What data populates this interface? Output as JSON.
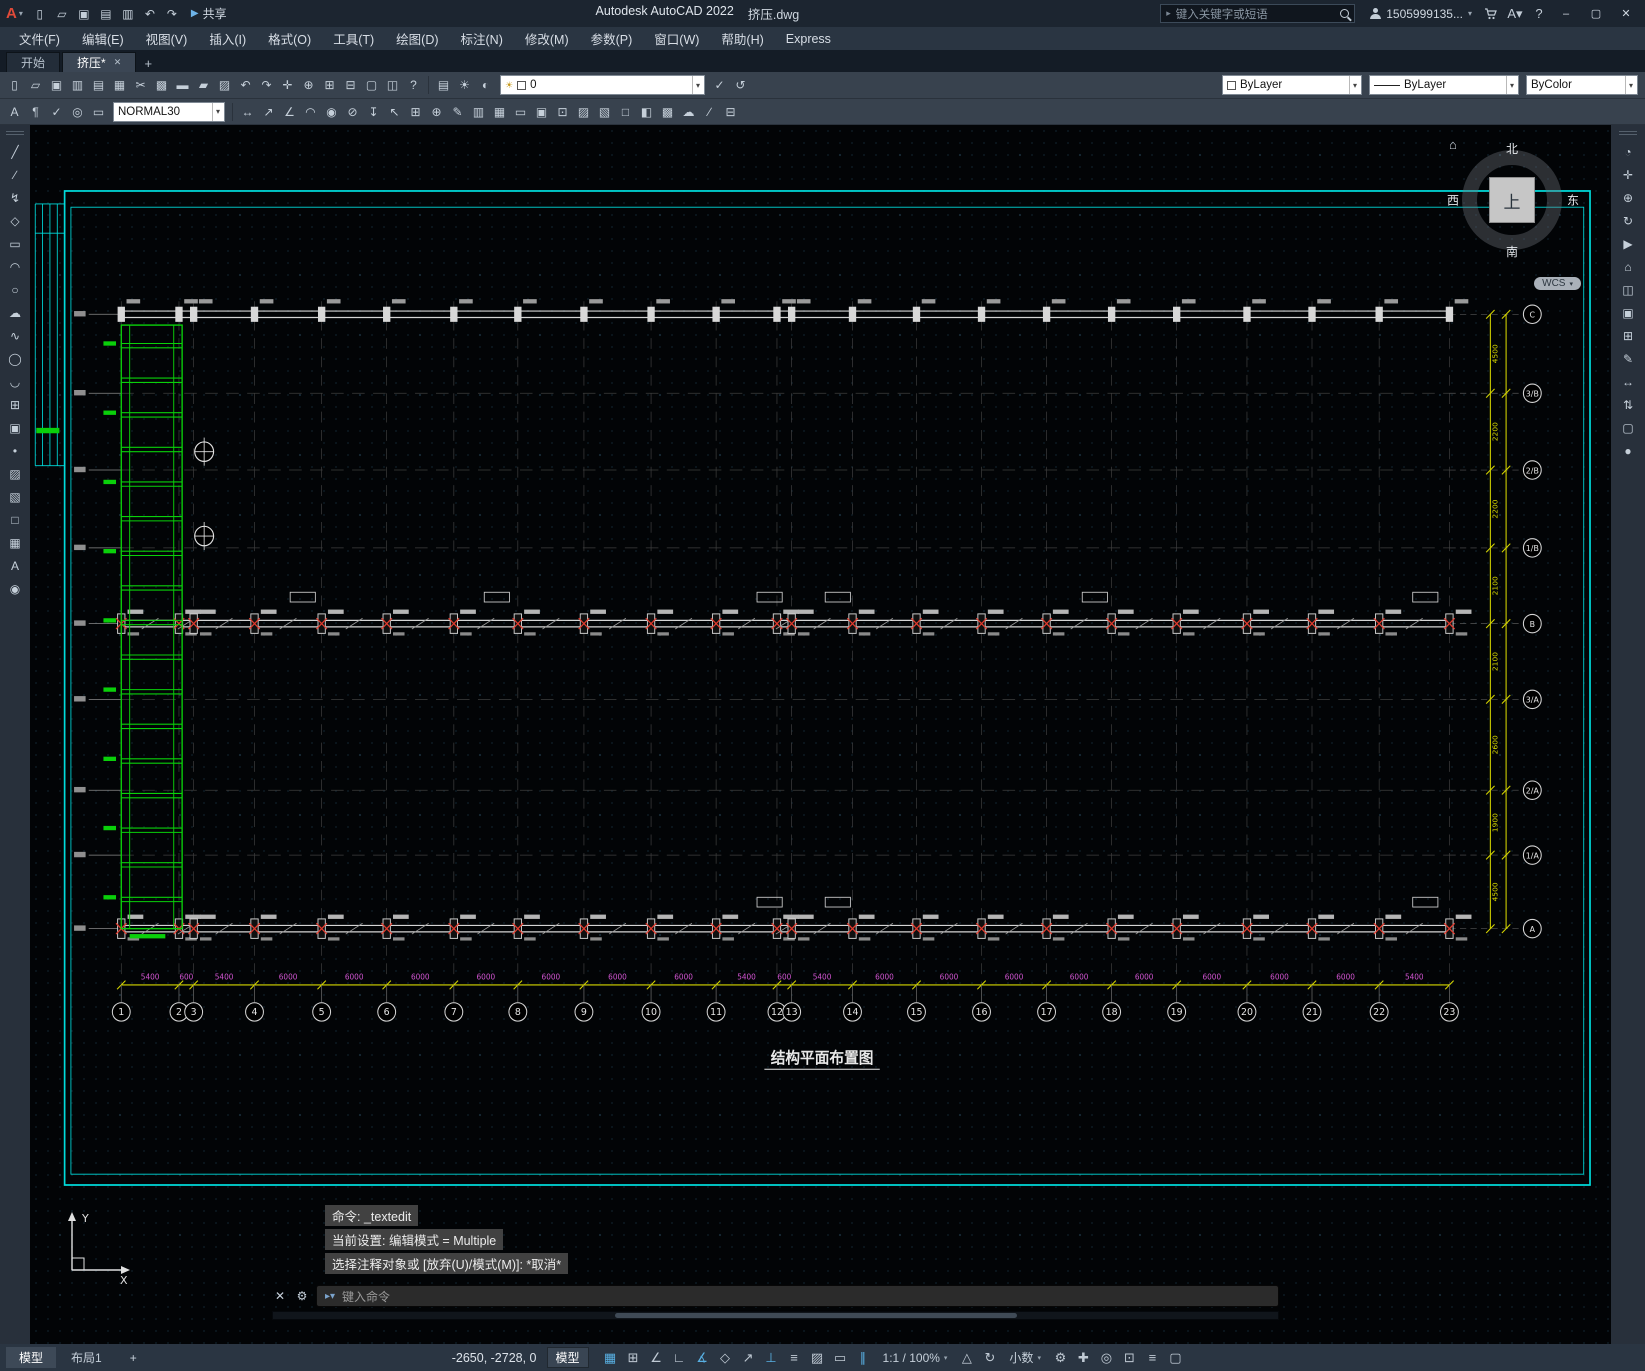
{
  "titlebar": {
    "app_title": "Autodesk AutoCAD 2022",
    "doc_title": "挤压.dwg",
    "share_label": "共享",
    "search_placeholder": "键入关键字或短语",
    "account": "1505999135...",
    "window_buttons": {
      "minimize": "–",
      "maximize": "▢",
      "close": "✕"
    },
    "quick_access": [
      {
        "name": "qnew",
        "glyph": "▯"
      },
      {
        "name": "open",
        "glyph": "▱"
      },
      {
        "name": "qsave",
        "glyph": "▣"
      },
      {
        "name": "save-as",
        "glyph": "▤"
      },
      {
        "name": "plot",
        "glyph": "▥"
      },
      {
        "name": "undo",
        "glyph": "↶"
      },
      {
        "name": "redo",
        "glyph": "↷"
      }
    ]
  },
  "menubar": {
    "items": [
      "文件(F)",
      "编辑(E)",
      "视图(V)",
      "插入(I)",
      "格式(O)",
      "工具(T)",
      "绘图(D)",
      "标注(N)",
      "修改(M)",
      "参数(P)",
      "窗口(W)",
      "帮助(H)",
      "Express"
    ]
  },
  "tabs": {
    "items": [
      {
        "label": "开始",
        "active": false
      },
      {
        "label": "挤压*",
        "active": true
      }
    ],
    "close_glyph": "✕",
    "new_tab": "+"
  },
  "toolbar1": {
    "icons_left": [
      {
        "name": "qnew",
        "glyph": "▯"
      },
      {
        "name": "open",
        "glyph": "▱"
      },
      {
        "name": "qsave",
        "glyph": "▣"
      },
      {
        "name": "plot",
        "glyph": "▥"
      },
      {
        "name": "plot-preview",
        "glyph": "▤"
      },
      {
        "name": "publish",
        "glyph": "▦"
      },
      {
        "name": "cut",
        "glyph": "✂"
      },
      {
        "name": "copy",
        "glyph": "▩"
      },
      {
        "name": "paste",
        "glyph": "▬"
      },
      {
        "name": "match-properties",
        "glyph": "▰"
      },
      {
        "name": "block-editor",
        "glyph": "▨"
      },
      {
        "name": "undo",
        "glyph": "↶"
      },
      {
        "name": "redo",
        "glyph": "↷"
      },
      {
        "name": "pan",
        "glyph": "✛"
      },
      {
        "name": "zoom-realtime",
        "glyph": "⊕"
      },
      {
        "name": "zoom-window",
        "glyph": "⊞"
      },
      {
        "name": "zoom-previous",
        "glyph": "⊟"
      },
      {
        "name": "properties",
        "glyph": "▢"
      },
      {
        "name": "design-center",
        "glyph": "◫"
      },
      {
        "name": "help",
        "glyph": "?"
      }
    ],
    "layer_icons": [
      {
        "name": "layer-properties",
        "glyph": "▤"
      },
      {
        "name": "layer-states",
        "glyph": "☀"
      },
      {
        "name": "layer-isolate",
        "glyph": "◐"
      }
    ],
    "layer_value": "0",
    "icons_mid": [
      {
        "name": "make-object-layer-current",
        "glyph": "✓"
      },
      {
        "name": "layer-previous",
        "glyph": "↺"
      }
    ],
    "color_value": "ByLayer",
    "linetype_value": "ByLayer",
    "plotstyle_value": "ByColor"
  },
  "toolbar2": {
    "icons_left": [
      {
        "name": "text",
        "glyph": "A"
      },
      {
        "name": "mtext",
        "glyph": "¶"
      },
      {
        "name": "spell-check",
        "glyph": "✓"
      },
      {
        "name": "find",
        "glyph": "◎"
      },
      {
        "name": "text-style",
        "glyph": "▭"
      }
    ],
    "style_value": "NORMAL30",
    "icons_right": [
      {
        "name": "dim-linear",
        "glyph": "↔"
      },
      {
        "name": "dim-aligned",
        "glyph": "↗"
      },
      {
        "name": "dim-angular",
        "glyph": "∠"
      },
      {
        "name": "dim-arc",
        "glyph": "◠"
      },
      {
        "name": "dim-radius",
        "glyph": "◉"
      },
      {
        "name": "dim-diameter",
        "glyph": "⊘"
      },
      {
        "name": "dim-ordinate",
        "glyph": "↧"
      },
      {
        "name": "multileader",
        "glyph": "↖"
      },
      {
        "name": "tolerance",
        "glyph": "⊞"
      },
      {
        "name": "center-mark",
        "glyph": "⊕"
      },
      {
        "name": "dim-edit",
        "glyph": "✎"
      },
      {
        "name": "dim-style",
        "glyph": "▥"
      },
      {
        "name": "table",
        "glyph": "▦"
      },
      {
        "name": "field",
        "glyph": "▭"
      },
      {
        "name": "make-block",
        "glyph": "▣"
      },
      {
        "name": "insert-block",
        "glyph": "⊡"
      },
      {
        "name": "hatch",
        "glyph": "▨"
      },
      {
        "name": "gradient",
        "glyph": "▧"
      },
      {
        "name": "boundary",
        "glyph": "□"
      },
      {
        "name": "region",
        "glyph": "◧"
      },
      {
        "name": "wipeout",
        "glyph": "▩"
      },
      {
        "name": "revision-cloud",
        "glyph": "☁"
      },
      {
        "name": "measure",
        "glyph": "∕"
      },
      {
        "name": "quick-calc",
        "glyph": "⊟"
      }
    ]
  },
  "left_palette": {
    "icons": [
      {
        "name": "line",
        "glyph": "╱"
      },
      {
        "name": "construction-line",
        "glyph": "∕"
      },
      {
        "name": "polyline",
        "glyph": "↯"
      },
      {
        "name": "polygon",
        "glyph": "◇"
      },
      {
        "name": "rectangle",
        "glyph": "▭"
      },
      {
        "name": "arc",
        "glyph": "◠"
      },
      {
        "name": "circle",
        "glyph": "○"
      },
      {
        "name": "revision-cloud",
        "glyph": "☁"
      },
      {
        "name": "spline",
        "glyph": "∿"
      },
      {
        "name": "ellipse",
        "glyph": "◯"
      },
      {
        "name": "ellipse-arc",
        "glyph": "◡"
      },
      {
        "name": "insert-block",
        "glyph": "⊞"
      },
      {
        "name": "create-block",
        "glyph": "▣"
      },
      {
        "name": "point",
        "glyph": "•"
      },
      {
        "name": "hatch",
        "glyph": "▨"
      },
      {
        "name": "gradient",
        "glyph": "▧"
      },
      {
        "name": "region",
        "glyph": "□"
      },
      {
        "name": "table",
        "glyph": "▦"
      },
      {
        "name": "multiline-text",
        "glyph": "A"
      },
      {
        "name": "color-tool",
        "glyph": "◉"
      }
    ]
  },
  "right_palette": {
    "icons": [
      {
        "name": "navigation-wheel",
        "glyph": "◔"
      },
      {
        "name": "pan",
        "glyph": "✛"
      },
      {
        "name": "zoom-extents",
        "glyph": "⊕"
      },
      {
        "name": "orbit",
        "glyph": "↻"
      },
      {
        "name": "show-motion",
        "glyph": "▶"
      },
      {
        "name": "home-view",
        "glyph": "⌂"
      },
      {
        "name": "view-manager",
        "glyph": "◫"
      },
      {
        "name": "named-views",
        "glyph": "▣"
      },
      {
        "name": "viewport-config",
        "glyph": "⊞"
      },
      {
        "name": "annotate",
        "glyph": "✎"
      },
      {
        "name": "move-view",
        "glyph": "↔"
      },
      {
        "name": "tilt-view",
        "glyph": "⇅"
      },
      {
        "name": "display-box",
        "glyph": "▢"
      },
      {
        "name": "render-dot",
        "glyph": "●"
      }
    ]
  },
  "canvas": {
    "compass": {
      "north": "北",
      "south": "南",
      "west": "西",
      "east": "东",
      "cube_top": "上"
    },
    "wcs_label": "WCS",
    "ucs": {
      "x_label": "X",
      "y_label": "Y"
    },
    "drawing": {
      "title": "结构平面布置图",
      "colors": {
        "outline": "#00dcdc",
        "beam": "#d4d4d4",
        "green": "#0ad00a",
        "yellow": "#d6d600",
        "red": "#e23b2e",
        "magenta": "#d255d2",
        "grid": "#454545"
      },
      "grid_labels": [
        "1",
        "2",
        "3",
        "4",
        "5",
        "6",
        "7",
        "8",
        "9",
        "10",
        "11",
        "12",
        "13",
        "14",
        "15",
        "16",
        "17",
        "18",
        "19",
        "20",
        "21",
        "22",
        "23"
      ],
      "grid_xs": [
        87,
        142,
        156,
        214,
        278,
        340,
        404,
        465,
        528,
        592,
        654,
        712,
        726,
        784,
        845,
        907,
        969,
        1031,
        1093,
        1160,
        1222,
        1286,
        1353
      ],
      "axis_labels": [
        "C",
        "3/B",
        "2/B",
        "1/B",
        "B",
        "3/A",
        "2/A",
        "1/A",
        "A"
      ],
      "axis_ys": [
        175,
        248,
        319,
        391,
        461,
        531,
        615,
        675,
        743
      ],
      "dims_bottom": [
        "5400",
        "600",
        "5400",
        "6000",
        "6000",
        "6000",
        "6000",
        "6000",
        "6000",
        "6000",
        "5400",
        "600",
        "5400",
        "6000",
        "6000",
        "6000",
        "6000",
        "6000",
        "6000",
        "6000",
        "6000",
        "5400"
      ],
      "dims_right": [
        "4500",
        "2200",
        "2200",
        "2100",
        "2100",
        "2600",
        "1900",
        "4500"
      ]
    }
  },
  "command": {
    "history": [
      "命令: _textedit",
      "当前设置: 编辑模式 = Multiple",
      "选择注释对象或 [放弃(U)/模式(M)]: *取消*"
    ],
    "prompt_placeholder": "键入命令"
  },
  "statusbar": {
    "layout_tabs": [
      "模型",
      "布局1"
    ],
    "new_layout": "+",
    "coords": "-2650, -2728, 0",
    "model_label": "模型",
    "icons_a": [
      {
        "name": "grid-display",
        "glyph": "▦",
        "active": true
      },
      {
        "name": "snap-mode",
        "glyph": "⊞"
      },
      {
        "name": "infer-constraints",
        "glyph": "∠"
      },
      {
        "name": "ortho-mode",
        "glyph": "∟"
      },
      {
        "name": "polar-tracking",
        "glyph": "∡",
        "active": true
      },
      {
        "name": "isometric-drafting",
        "glyph": "◇"
      },
      {
        "name": "object-snap-tracking",
        "glyph": "↗"
      },
      {
        "name": "object-snap",
        "glyph": "⊥",
        "active": true
      },
      {
        "name": "lineweight-display",
        "glyph": "≡"
      },
      {
        "name": "transparency",
        "glyph": "▨"
      },
      {
        "name": "selection-cycling",
        "glyph": "▭"
      },
      {
        "name": "dynamic-ucs",
        "glyph": "∥",
        "active": true
      }
    ],
    "scale_label": "1:1 / 100%",
    "icons_b": [
      {
        "name": "annotation-visibility",
        "glyph": "△"
      },
      {
        "name": "autoscale",
        "glyph": "↻"
      }
    ],
    "units_label": "小数",
    "icons_c": [
      {
        "name": "workspace-switching",
        "glyph": "⚙"
      },
      {
        "name": "annotation-monitor",
        "glyph": "✚"
      },
      {
        "name": "isolate-objects",
        "glyph": "◎"
      },
      {
        "name": "graphics-performance",
        "glyph": "⊡"
      },
      {
        "name": "customize",
        "glyph": "≡"
      },
      {
        "name": "clean-screen",
        "glyph": "▢"
      }
    ]
  }
}
